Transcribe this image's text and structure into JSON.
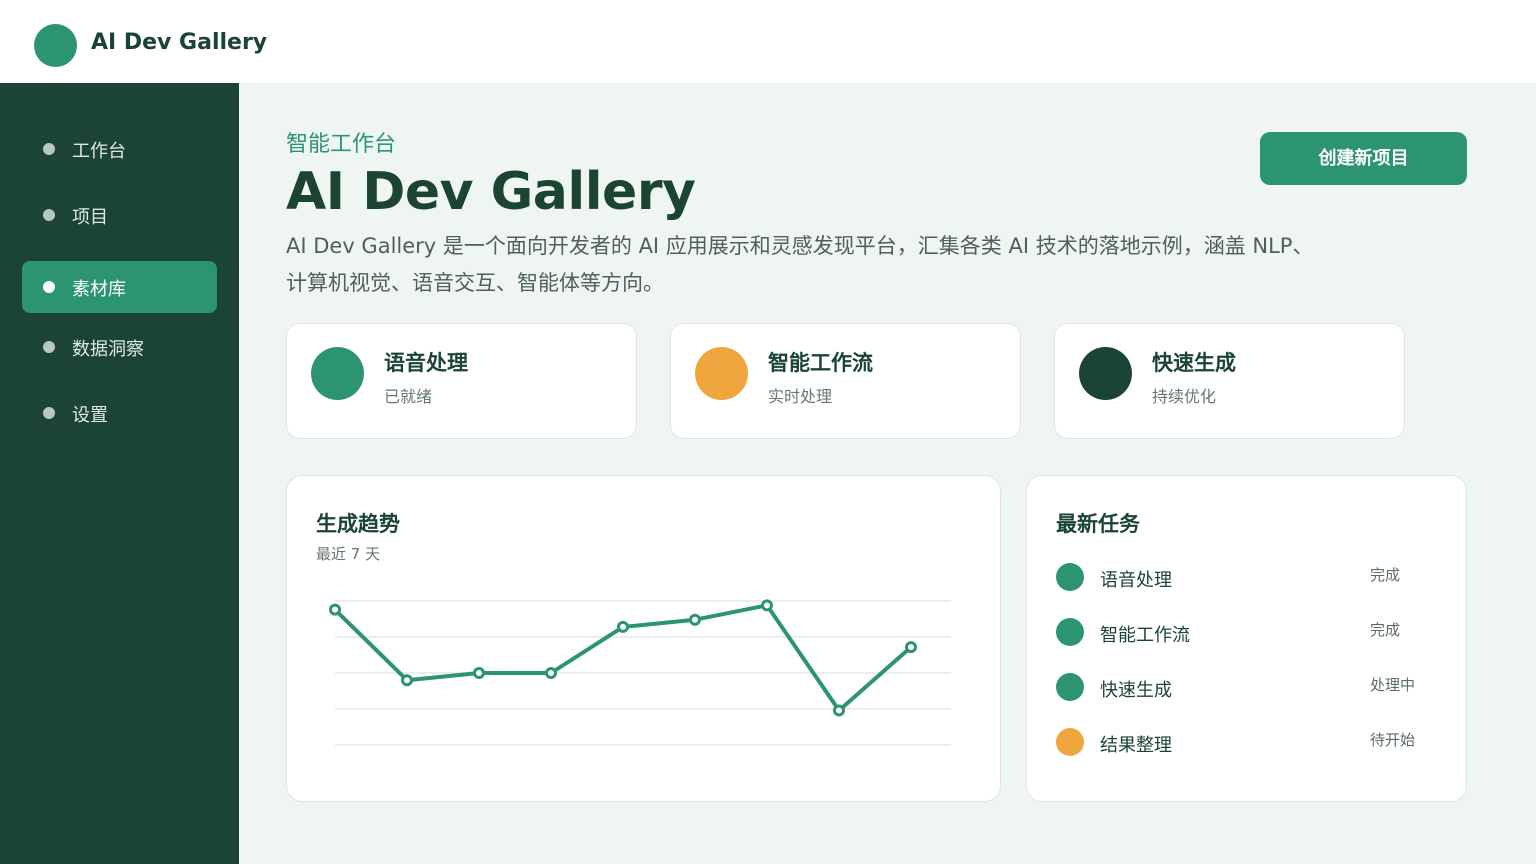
{
  "app": {
    "title": "AI Dev Gallery"
  },
  "colors": {
    "primary": "#2c9470",
    "accent": "#f0a63f",
    "dark": "#1c4436"
  },
  "sidebar": {
    "items": [
      {
        "label": "工作台",
        "active": false
      },
      {
        "label": "项目",
        "active": false
      },
      {
        "label": "素材库",
        "active": true
      },
      {
        "label": "数据洞察",
        "active": false
      },
      {
        "label": "设置",
        "active": false
      }
    ]
  },
  "hero": {
    "eyebrow": "智能工作台",
    "title": "AI Dev Gallery",
    "description": "AI Dev Gallery 是一个面向开发者的 AI 应用展示和灵感发现平台，汇集各类 AI 技术的落地示例，涵盖 NLP、计算机视觉、语音交互、智能体等方向。",
    "create_button": "创建新项目"
  },
  "stats": [
    {
      "title": "语音处理",
      "subtitle": "已就绪",
      "color": "#2c9470"
    },
    {
      "title": "智能工作流",
      "subtitle": "实时处理",
      "color": "#f0a63f"
    },
    {
      "title": "快速生成",
      "subtitle": "持续优化",
      "color": "#1c4436"
    }
  ],
  "trend": {
    "title": "生成趋势",
    "subtitle": "最近 7 天"
  },
  "chart_data": {
    "type": "line",
    "x": [
      1,
      2,
      3,
      4,
      5,
      6,
      7,
      8,
      9
    ],
    "series": [
      {
        "values": [
          94,
          45,
          50,
          50,
          82,
          87,
          97,
          24,
          68
        ]
      }
    ],
    "ylim": [
      0,
      100
    ],
    "grid": true
  },
  "tasks": {
    "title": "最新任务",
    "items": [
      {
        "name": "语音处理",
        "status": "完成",
        "color": "#2c9470"
      },
      {
        "name": "智能工作流",
        "status": "完成",
        "color": "#2c9470"
      },
      {
        "name": "快速生成",
        "status": "处理中",
        "color": "#2c9470"
      },
      {
        "name": "结果整理",
        "status": "待开始",
        "color": "#f0a63f"
      }
    ]
  }
}
